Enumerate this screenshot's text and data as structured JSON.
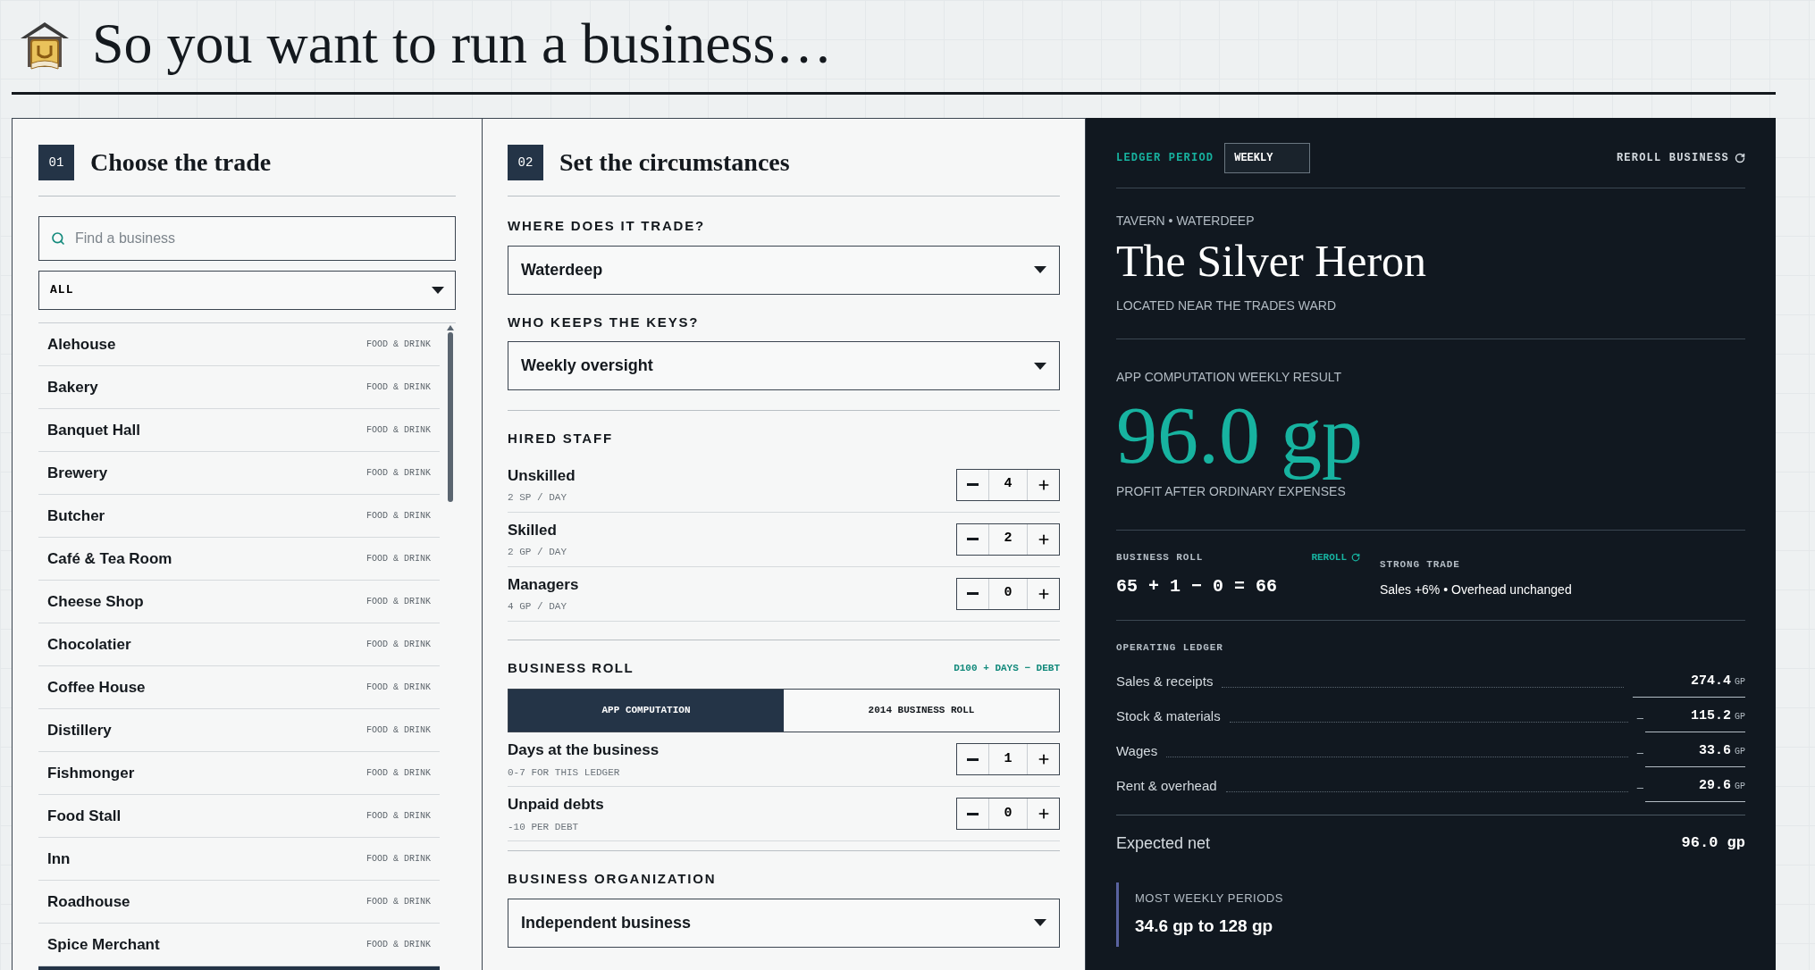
{
  "header": {
    "title": "So you want to run a business…"
  },
  "trade_panel": {
    "number": "01",
    "title": "Choose the trade",
    "search": {
      "placeholder": "Find a business"
    },
    "filter": {
      "value": "ALL"
    },
    "items": [
      {
        "name": "Alehouse",
        "category": "FOOD & DRINK"
      },
      {
        "name": "Bakery",
        "category": "FOOD & DRINK"
      },
      {
        "name": "Banquet Hall",
        "category": "FOOD & DRINK"
      },
      {
        "name": "Brewery",
        "category": "FOOD & DRINK"
      },
      {
        "name": "Butcher",
        "category": "FOOD & DRINK"
      },
      {
        "name": "Café & Tea Room",
        "category": "FOOD & DRINK"
      },
      {
        "name": "Cheese Shop",
        "category": "FOOD & DRINK"
      },
      {
        "name": "Chocolatier",
        "category": "FOOD & DRINK"
      },
      {
        "name": "Coffee House",
        "category": "FOOD & DRINK"
      },
      {
        "name": "Distillery",
        "category": "FOOD & DRINK"
      },
      {
        "name": "Fishmonger",
        "category": "FOOD & DRINK"
      },
      {
        "name": "Food Stall",
        "category": "FOOD & DRINK"
      },
      {
        "name": "Inn",
        "category": "FOOD & DRINK"
      },
      {
        "name": "Roadhouse",
        "category": "FOOD & DRINK"
      },
      {
        "name": "Spice Merchant",
        "category": "FOOD & DRINK"
      }
    ]
  },
  "circumstances": {
    "number": "02",
    "title": "Set the circumstances",
    "location": {
      "label": "WHERE DOES IT TRADE?",
      "value": "Waterdeep"
    },
    "keys": {
      "label": "WHO KEEPS THE KEYS?",
      "value": "Weekly oversight"
    },
    "staff": {
      "title": "HIRED STAFF",
      "rows": [
        {
          "name": "Unskilled",
          "note": "2 SP / DAY",
          "count": "4"
        },
        {
          "name": "Skilled",
          "note": "2 GP / DAY",
          "count": "2"
        },
        {
          "name": "Managers",
          "note": "4 GP / DAY",
          "count": "0"
        }
      ]
    },
    "roll": {
      "title": "BUSINESS ROLL",
      "formula": "D100 + DAYS − DEBT",
      "modes": [
        {
          "label": "APP COMPUTATION",
          "selected": true
        },
        {
          "label": "2014 BUSINESS ROLL",
          "selected": false
        }
      ],
      "rows": [
        {
          "name": "Days at the business",
          "note": "0-7 FOR THIS LEDGER",
          "count": "1"
        },
        {
          "name": "Unpaid debts",
          "note": "-10 PER DEBT",
          "count": "0"
        }
      ]
    },
    "organization": {
      "label": "BUSINESS ORGANIZATION",
      "value": "Independent business"
    }
  },
  "result": {
    "period_label": "LEDGER PERIOD",
    "period_value": "WEEKLY",
    "reroll_label": "REROLL BUSINESS",
    "subtitle": "TAVERN • WATERDEEP",
    "name": "The Silver Heron",
    "location_note": "LOCATED NEAR THE TRADES WARD",
    "result_label": "APP COMPUTATION WEEKLY RESULT",
    "amount": "96.0 gp",
    "amount_note": "PROFIT AFTER ORDINARY EXPENSES",
    "business_roll": {
      "label": "BUSINESS ROLL",
      "reroll": "REROLL",
      "equation": "65 + 1 − 0 = 66"
    },
    "trade": {
      "label": "STRONG TRADE",
      "note": "Sales +6% • Overhead unchanged"
    },
    "ledger": {
      "title": "OPERATING LEDGER",
      "rows": [
        {
          "label": "Sales & receipts",
          "value": "274.4",
          "unit": "GP"
        },
        {
          "label": "Stock & materials",
          "sign": "–",
          "value": "115.2",
          "unit": "GP"
        },
        {
          "label": "Wages",
          "sign": "–",
          "value": "33.6",
          "unit": "GP"
        },
        {
          "label": "Rent & overhead",
          "sign": "–",
          "value": "29.6",
          "unit": "GP"
        }
      ]
    },
    "net": {
      "label": "Expected net",
      "value": "96.0 gp"
    },
    "range": {
      "label": "MOST WEEKLY PERIODS",
      "value": "34.6 gp to 128 gp"
    }
  }
}
